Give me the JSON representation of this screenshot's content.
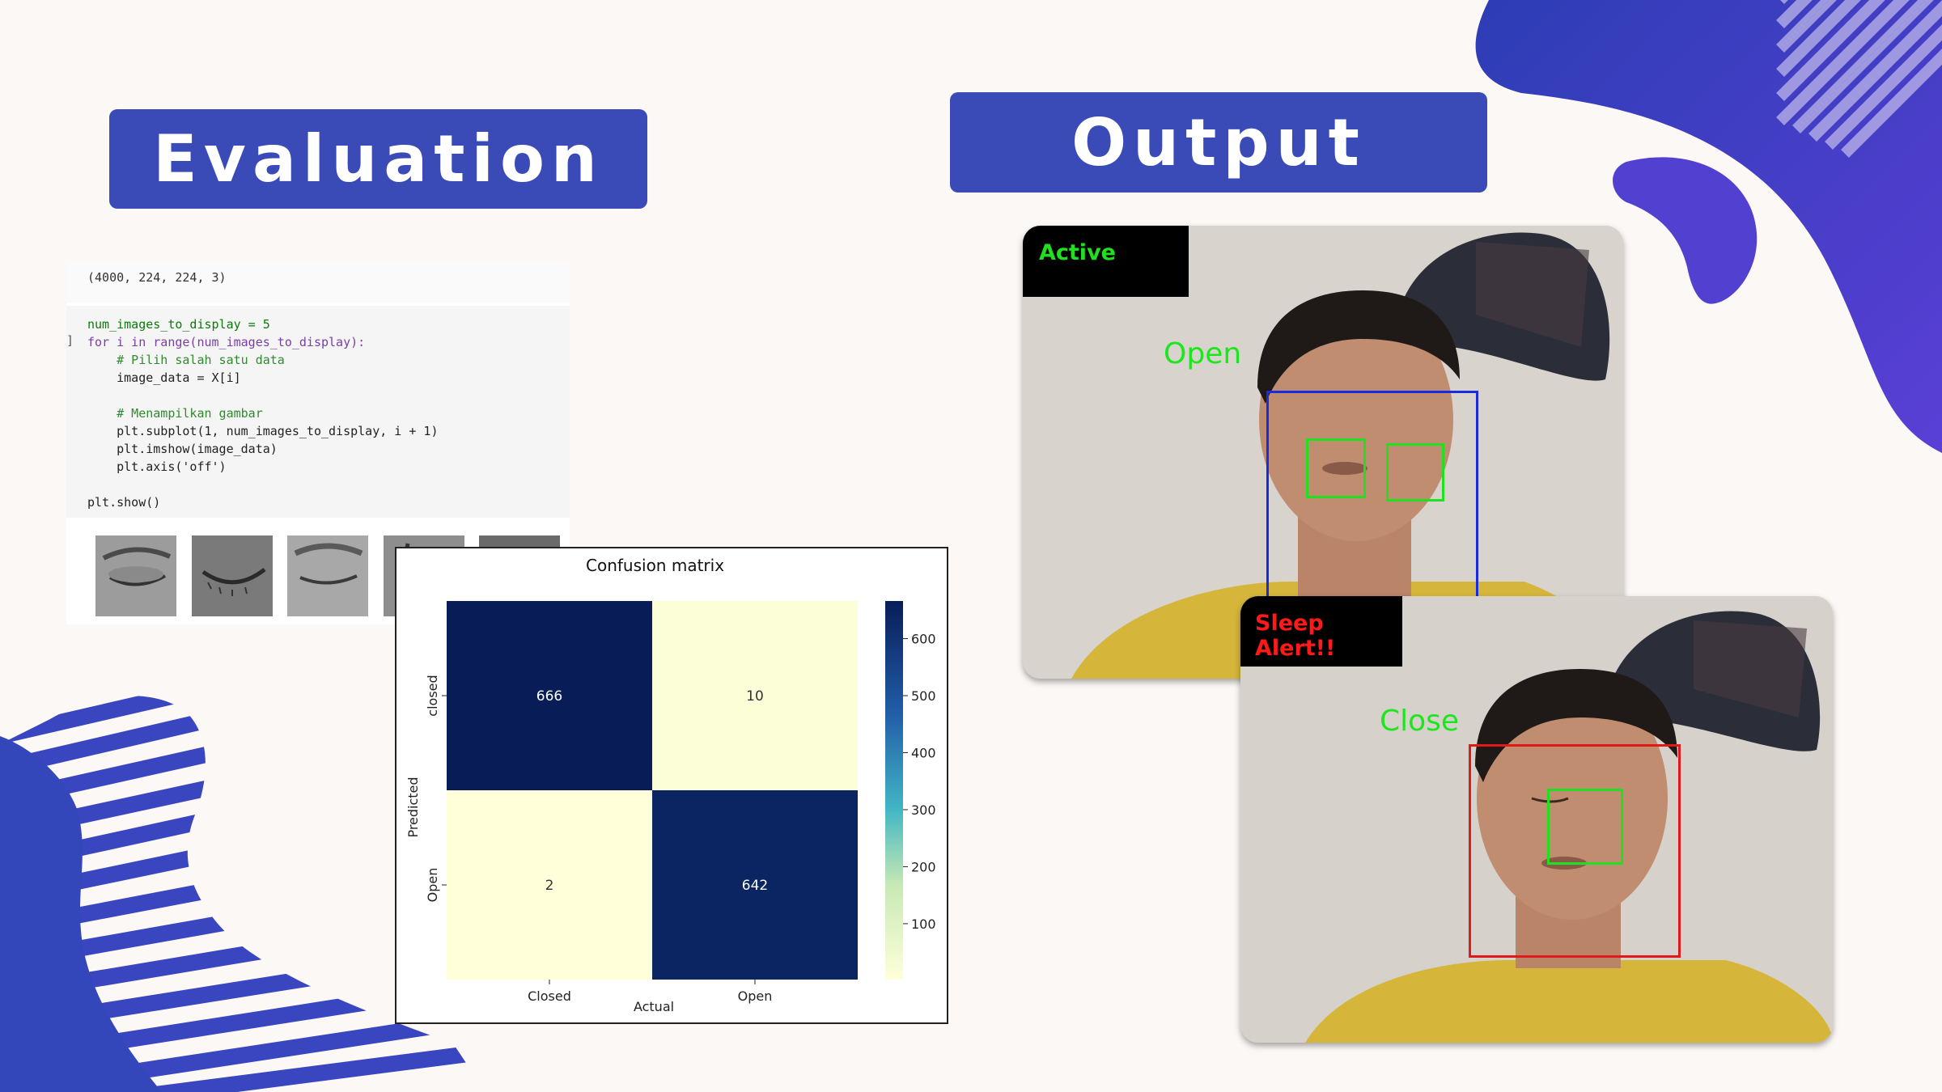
{
  "slide": {
    "evaluation_title": "Evaluation",
    "output_title": "Output",
    "accent": "#3a4bb8",
    "background": "#fcf8f6"
  },
  "code": {
    "output_line": "(4000, 224, 224, 3)",
    "prompt": "]",
    "lines": [
      "num_images_to_display = 5",
      "for i in range(num_images_to_display):",
      "    # Pilih salah satu data",
      "    image_data = X[i]",
      "",
      "    # Menampilkan gambar",
      "    plt.subplot(1, num_images_to_display, i + 1)",
      "    plt.imshow(image_data)",
      "    plt.axis('off')",
      "",
      "plt.show()"
    ],
    "thumbnails": [
      "closed-eye",
      "closed-eye",
      "closed-eye",
      "closed-eye",
      "open-eye"
    ]
  },
  "chart_data": {
    "type": "heatmap",
    "title": "Confusion matrix",
    "xlabel": "Actual",
    "ylabel": "Predicted",
    "x_categories": [
      "Closed",
      "Open"
    ],
    "y_categories": [
      "closed",
      "Open"
    ],
    "values": [
      [
        666,
        10
      ],
      [
        2,
        642
      ]
    ],
    "colorbar_ticks": [
      "600",
      "500",
      "400",
      "300",
      "200",
      "100"
    ],
    "colorbar_range": [
      2,
      666
    ],
    "colormap": "YlGnBu"
  },
  "output": {
    "active_frame": {
      "status_label": "Active",
      "status_color": "#20e020",
      "state_text": "Open",
      "face_box_color": "#1a2be0",
      "eye_box_color": "#20e020"
    },
    "alert_frame": {
      "status_label": "Sleep Alert!!",
      "status_color": "#ff1a1a",
      "state_text": "Close",
      "face_box_color": "#e01a1a",
      "eye_box_color": "#20e020"
    }
  }
}
